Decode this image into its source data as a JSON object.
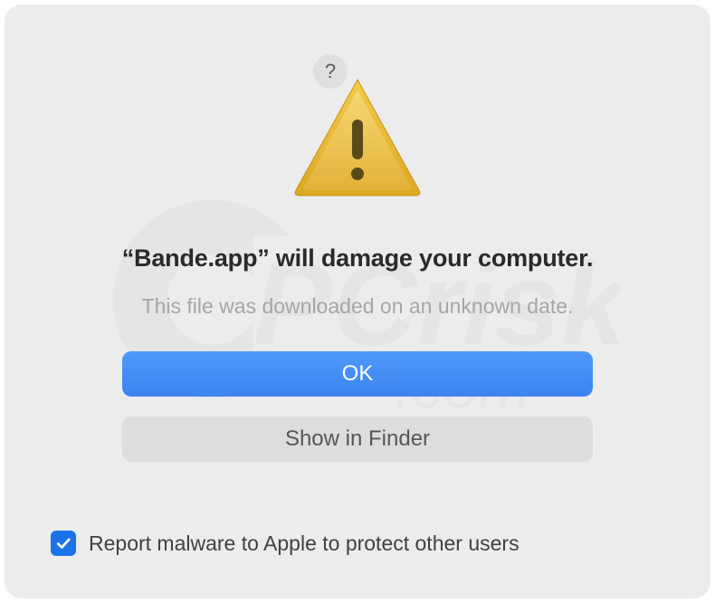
{
  "dialog": {
    "help_aria": "Help",
    "title": "“Bande.app” will damage your computer.",
    "subtitle": "This file was downloaded on an unknown date.",
    "primary_button": "OK",
    "secondary_button": "Show in Finder",
    "checkbox_label": "Report malware to Apple to protect other users",
    "checkbox_checked": true
  },
  "colors": {
    "primary_button_bg": "#3b84f0",
    "checkbox_bg": "#1a74e8",
    "dialog_bg": "#ececec"
  }
}
